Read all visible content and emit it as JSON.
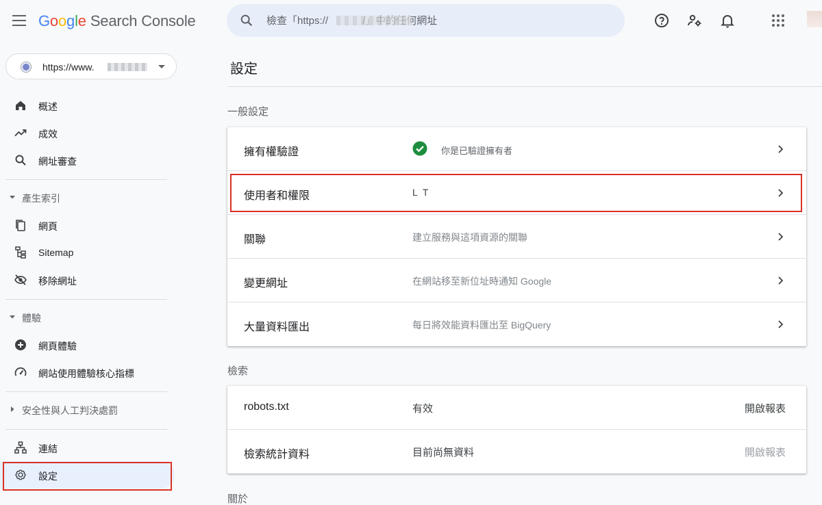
{
  "app": {
    "logo_google": "Google",
    "logo_product": "Search Console"
  },
  "search": {
    "placeholder": "檢查「https://            /」中的任何網址"
  },
  "property": {
    "url": "https://www."
  },
  "nav": {
    "overview": "概述",
    "performance": "成效",
    "url_inspection": "網址審查",
    "indexing_header": "產生索引",
    "pages": "網頁",
    "sitemaps": "Sitemap",
    "removals": "移除網址",
    "experience_header": "體驗",
    "page_experience": "網頁體驗",
    "core_web_vitals": "網站使用體驗核心指標",
    "security_header": "安全性與人工判決處罰",
    "links": "連結",
    "settings": "設定"
  },
  "page": {
    "title": "設定"
  },
  "general": {
    "header": "一般設定",
    "rows": [
      {
        "label": "擁有權驗證",
        "value": "你是已驗證擁有者"
      },
      {
        "label": "使用者和權限",
        "value": "L T"
      },
      {
        "label": "關聯",
        "value": "建立服務與這項資源的關聯"
      },
      {
        "label": "變更網址",
        "value": "在網站移至新位址時通知 Google"
      },
      {
        "label": "大量資料匯出",
        "value": "每日將效能資料匯出至 BigQuery"
      }
    ]
  },
  "crawling": {
    "header": "檢索",
    "rows": [
      {
        "label": "robots.txt",
        "value": "有效",
        "action": "開啟報表"
      },
      {
        "label": "檢索統計資料",
        "value": "目前尚無資料",
        "action": "開啟報表"
      }
    ]
  },
  "about": {
    "header": "關於"
  },
  "colors": {
    "accent": "#1a73e8",
    "highlight": "#d93025",
    "success": "#1e8e3e",
    "active_bg": "#e8f0fe"
  }
}
